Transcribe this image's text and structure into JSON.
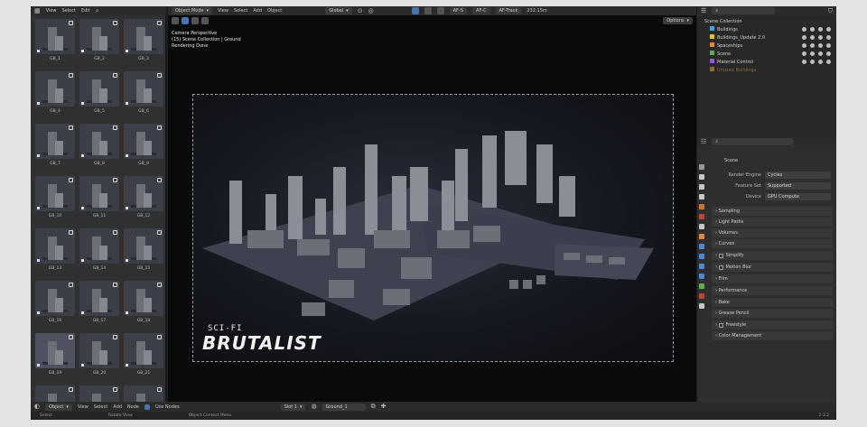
{
  "top_menu": [
    "View",
    "Select",
    "Edit"
  ],
  "viewport_header": {
    "mode": "Object Mode",
    "menus": [
      "View",
      "Select",
      "Add",
      "Object"
    ],
    "transform": "Global",
    "af_s": "AF-S",
    "af_c": "AF-C",
    "af_track": "AF-Track",
    "distance": "232.15m",
    "options": "Options"
  },
  "hud": {
    "line1": "Camera Perspective",
    "line2": "(15) Scene Collection | Ground",
    "line3": "Rendering Done"
  },
  "render_title": {
    "small": "SCI-FI",
    "big": "BRUTALIST"
  },
  "assets": [
    "GB_1",
    "GB_2",
    "GB_3",
    "GB_4",
    "GB_5",
    "GB_6",
    "GB_7",
    "GB_8",
    "GB_9",
    "GB_10",
    "GB_11",
    "GB_12",
    "GB_13",
    "GB_14",
    "GB_15",
    "GB_16",
    "GB_17",
    "GB_18",
    "GB_19",
    "GB_20",
    "GB_21",
    "",
    "",
    ""
  ],
  "outliner": {
    "root": "Scene Collection",
    "items": [
      {
        "name": "Buildings",
        "color": "#4aa3d8"
      },
      {
        "name": "Buildings_Update 2.0",
        "color": "#e0c04a"
      },
      {
        "name": "Spaceships",
        "color": "#e08a3a"
      },
      {
        "name": "Scene",
        "color": "#6aa84f"
      },
      {
        "name": "Material Control",
        "color": "#8e5bd4"
      },
      {
        "name": "Unused Buildings",
        "color": "#8a6a3a"
      }
    ]
  },
  "properties": {
    "header": "Scene",
    "render_engine_label": "Render Engine",
    "render_engine": "Cycles",
    "feature_set_label": "Feature Set",
    "feature_set": "Supported",
    "device_label": "Device",
    "device": "GPU Compute",
    "sections": [
      "Sampling",
      "Light Paths",
      "Volumes",
      "Curves",
      "Simplify",
      "Motion Blur",
      "Film",
      "Performance",
      "Bake",
      "Grease Pencil",
      "Freestyle",
      "Color Management"
    ]
  },
  "node_header": {
    "object": "Object",
    "menus": [
      "View",
      "Select",
      "Add",
      "Node"
    ],
    "use_nodes": "Use Nodes",
    "slot": "Slot 1",
    "material": "Ground_1"
  },
  "status": {
    "select": "Select",
    "rotate": "Rotate View",
    "context": "Object Context Menu",
    "version": "2.3.2"
  }
}
